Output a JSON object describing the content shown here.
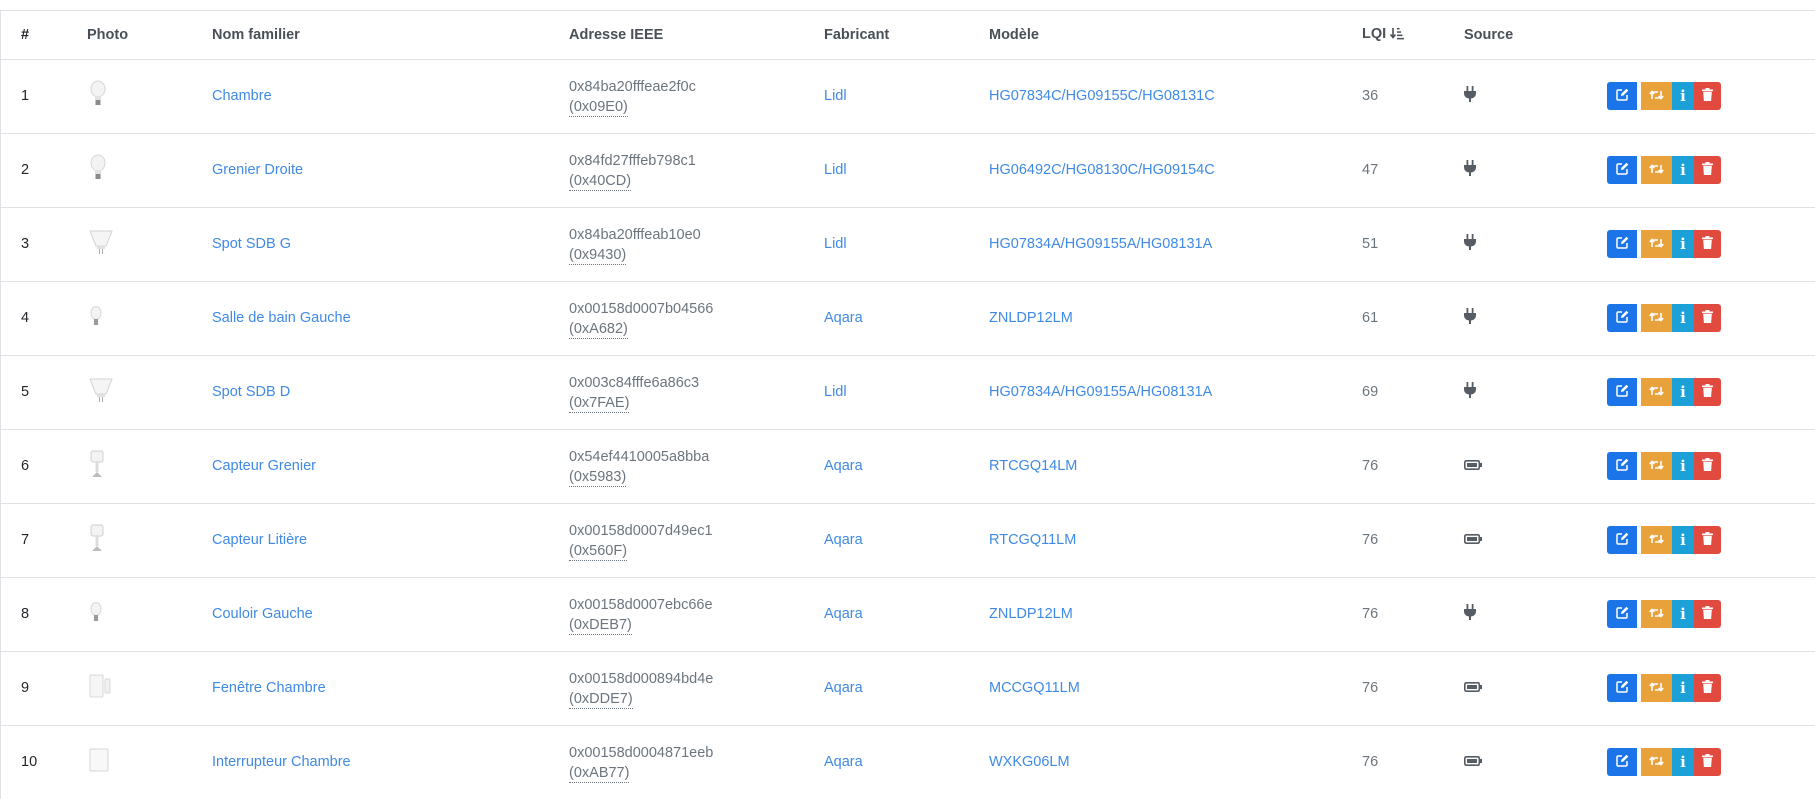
{
  "columns": {
    "num": "#",
    "photo": "Photo",
    "name": "Nom familier",
    "ieee": "Adresse IEEE",
    "manufacturer": "Fabricant",
    "model": "Modèle",
    "lqi": "LQI",
    "source": "Source"
  },
  "rows": [
    {
      "num": "1",
      "photo": "bulb-icon",
      "name": "Chambre",
      "ieee": "0x84ba20fffeae2f0c",
      "nwk": "(0x09E0)",
      "manufacturer": "Lidl",
      "model": "HG07834C/HG09155C/HG08131C",
      "lqi": "36",
      "source": "plug-icon"
    },
    {
      "num": "2",
      "photo": "bulb-icon",
      "name": "Grenier Droite",
      "ieee": "0x84fd27fffeb798c1",
      "nwk": "(0x40CD)",
      "manufacturer": "Lidl",
      "model": "HG06492C/HG08130C/HG09154C",
      "lqi": "47",
      "source": "plug-icon"
    },
    {
      "num": "3",
      "photo": "spot-icon",
      "name": "Spot SDB G",
      "ieee": "0x84ba20fffeab10e0",
      "nwk": "(0x9430)",
      "manufacturer": "Lidl",
      "model": "HG07834A/HG09155A/HG08131A",
      "lqi": "51",
      "source": "plug-icon"
    },
    {
      "num": "4",
      "photo": "small-bulb-icon",
      "name": "Salle de bain Gauche",
      "ieee": "0x00158d0007b04566",
      "nwk": "(0xA682)",
      "manufacturer": "Aqara",
      "model": "ZNLDP12LM",
      "lqi": "61",
      "source": "plug-icon"
    },
    {
      "num": "5",
      "photo": "spot-icon",
      "name": "Spot SDB D",
      "ieee": "0x003c84fffe6a86c3",
      "nwk": "(0x7FAE)",
      "manufacturer": "Lidl",
      "model": "HG07834A/HG09155A/HG08131A",
      "lqi": "69",
      "source": "plug-icon"
    },
    {
      "num": "6",
      "photo": "sensor-icon",
      "name": "Capteur Grenier",
      "ieee": "0x54ef4410005a8bba",
      "nwk": "(0x5983)",
      "manufacturer": "Aqara",
      "model": "RTCGQ14LM",
      "lqi": "76",
      "source": "battery-icon"
    },
    {
      "num": "7",
      "photo": "sensor-icon",
      "name": "Capteur Litière",
      "ieee": "0x00158d0007d49ec1",
      "nwk": "(0x560F)",
      "manufacturer": "Aqara",
      "model": "RTCGQ11LM",
      "lqi": "76",
      "source": "battery-icon"
    },
    {
      "num": "8",
      "photo": "small-bulb-icon",
      "name": "Couloir Gauche",
      "ieee": "0x00158d0007ebc66e",
      "nwk": "(0xDEB7)",
      "manufacturer": "Aqara",
      "model": "ZNLDP12LM",
      "lqi": "76",
      "source": "plug-icon"
    },
    {
      "num": "9",
      "photo": "contact-icon",
      "name": "Fenêtre Chambre",
      "ieee": "0x00158d000894bd4e",
      "nwk": "(0xDDE7)",
      "manufacturer": "Aqara",
      "model": "MCCGQ11LM",
      "lqi": "76",
      "source": "battery-icon"
    },
    {
      "num": "10",
      "photo": "switch-icon",
      "name": "Interrupteur Chambre",
      "ieee": "0x00158d0004871eeb",
      "nwk": "(0xAB77)",
      "manufacturer": "Aqara",
      "model": "WXKG06LM",
      "lqi": "76",
      "source": "battery-icon"
    }
  ],
  "colors": {
    "link": "#3f8ae6",
    "edit": "#1b75e8",
    "swap": "#e9a23b",
    "info": "#1ba1d8",
    "delete": "#e04a3f"
  }
}
